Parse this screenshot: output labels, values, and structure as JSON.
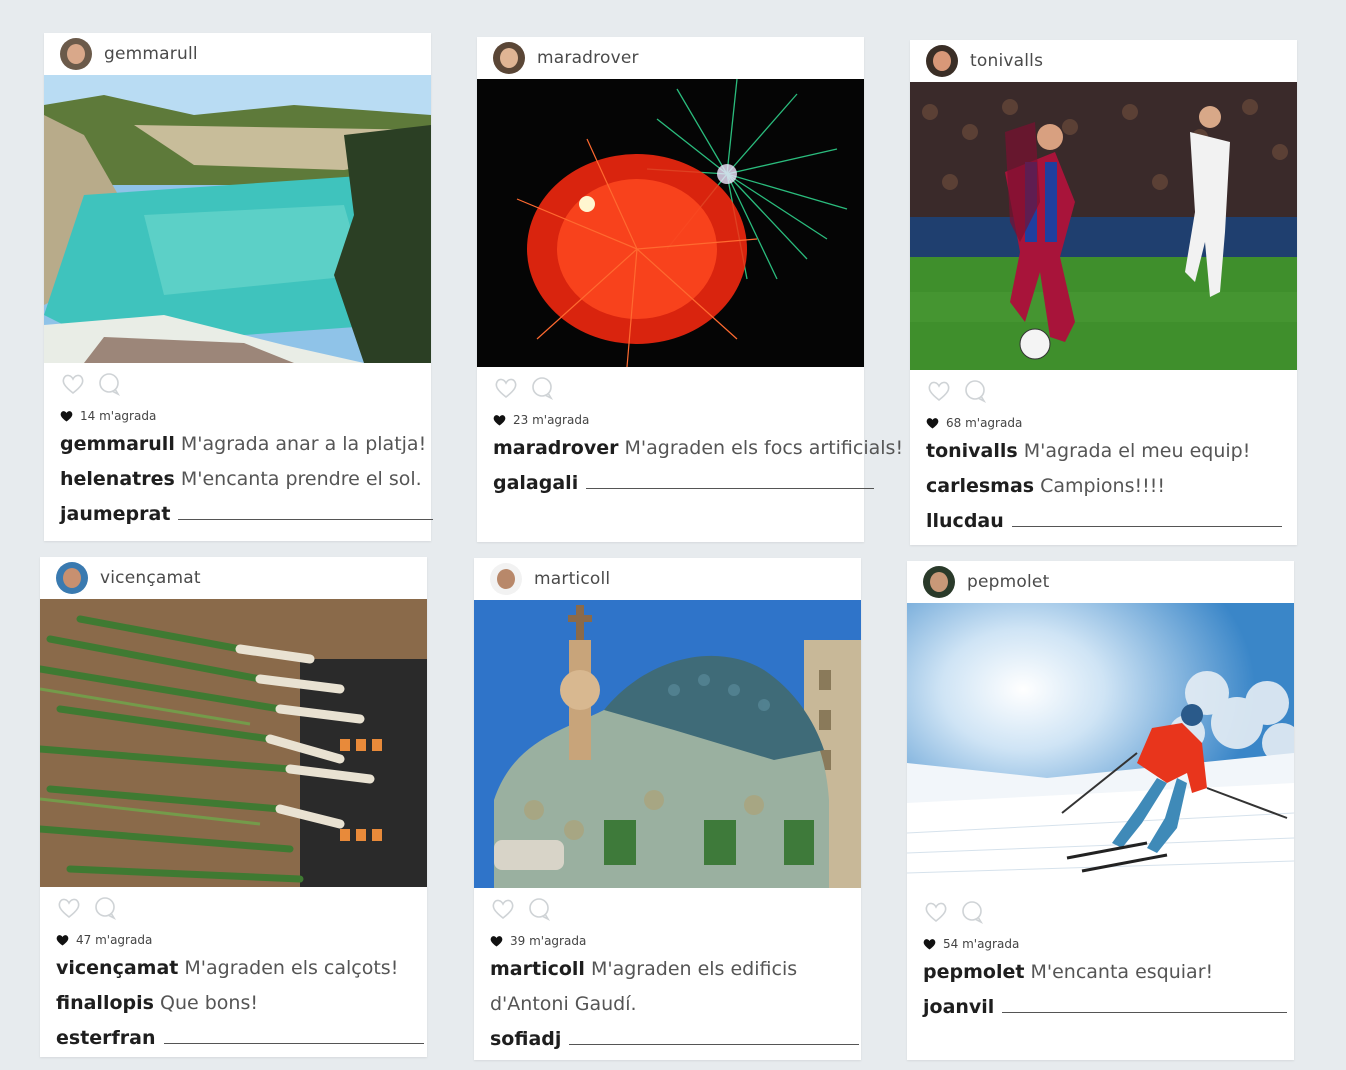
{
  "posts": [
    {
      "user": "gemmarull",
      "likes": "14 m'agrada",
      "comments": [
        {
          "user": "gemmarull",
          "text": "M'agrada anar a la platja!"
        },
        {
          "user": "helenatres",
          "text": "M'encanta prendre el sol."
        }
      ],
      "blank_user": "jaumeprat",
      "photo": "beach-cove",
      "colors": {
        "sky": "#8fc3e8",
        "water": "#3fc3bd",
        "rock": "#b9b49a"
      }
    },
    {
      "user": "maradrover",
      "likes": "23 m'agrada",
      "comments": [
        {
          "user": "maradrover",
          "text": "M'agraden els focs artificials!"
        }
      ],
      "blank_user": "galagali",
      "photo": "fireworks",
      "colors": {
        "sky": "#050505",
        "red": "#ff2a10",
        "green": "#2fd08a"
      }
    },
    {
      "user": "tonivalls",
      "likes": "68 m'agrada",
      "comments": [
        {
          "user": "tonivalls",
          "text": "M'agrada el meu equip!"
        },
        {
          "user": "carlesmas",
          "text": "Campions!!!!"
        }
      ],
      "blank_user": "llucdau",
      "photo": "football",
      "colors": {
        "grass": "#3f8f2c",
        "crowd": "#3a2a2a"
      }
    },
    {
      "user": "vicençamat",
      "likes": "47 m'agrada",
      "comments": [
        {
          "user": "vicençamat",
          "text": "M'agraden els calçots!"
        },
        {
          "user": "finallopis",
          "text": "Que bons!"
        }
      ],
      "blank_user": "esterfran",
      "photo": "calcots",
      "colors": {
        "green": "#3f7a32",
        "white": "#e9e2d2"
      }
    },
    {
      "user": "marticoll",
      "likes": "39 m'agrada",
      "comments": [
        {
          "user": "marticoll",
          "text": "M'agraden els edificis"
        },
        {
          "user": "",
          "text": "d'Antoni Gaudí."
        }
      ],
      "blank_user": "sofiadj",
      "photo": "casa-batllo",
      "colors": {
        "sky": "#2f74c9",
        "roof": "#3f6b78"
      }
    },
    {
      "user": "pepmolet",
      "likes": "54 m'agrada",
      "comments": [
        {
          "user": "pepmolet",
          "text": "M'encanta esquiar!"
        }
      ],
      "blank_user": "joanvil",
      "photo": "skier",
      "colors": {
        "sky": "#3a86c8",
        "snow": "#f2f6fa",
        "jacket": "#e8351c"
      }
    }
  ]
}
